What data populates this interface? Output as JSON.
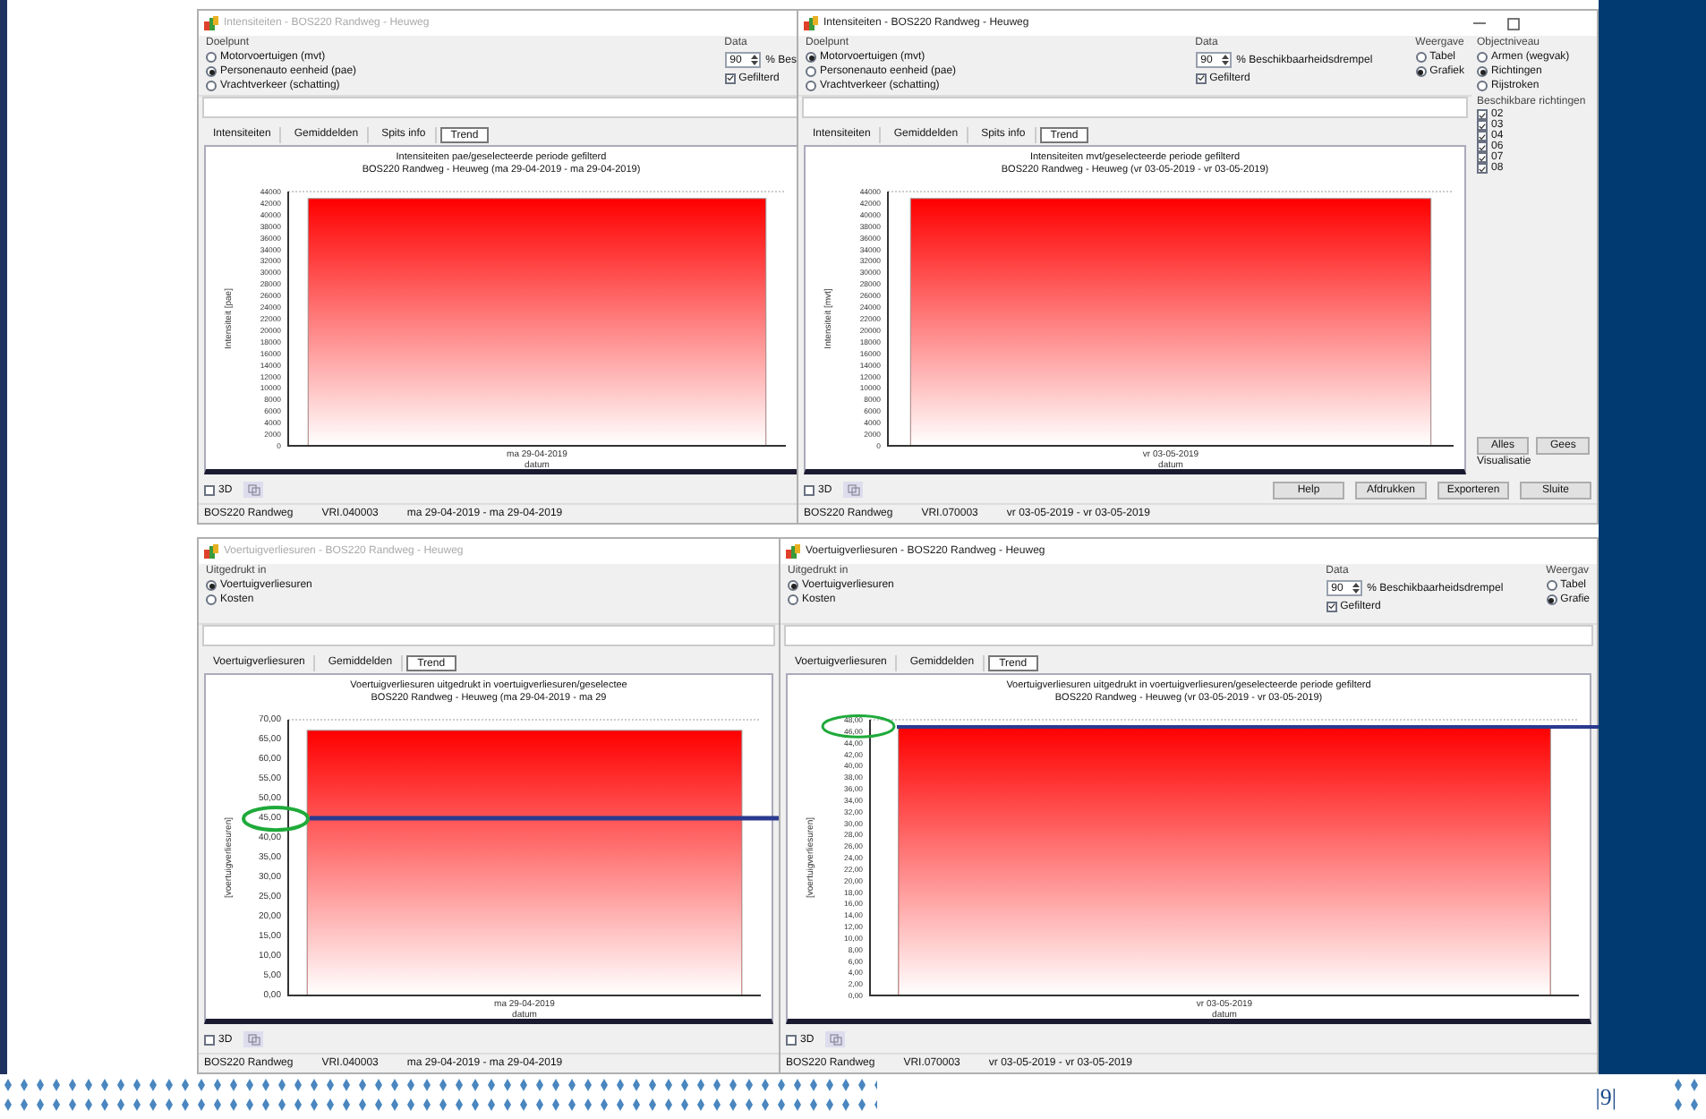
{
  "windows": [
    {
      "title": "Intensiteiten - BOS220 Randweg - Heuweg",
      "active": false,
      "window_buttons": false,
      "groups": [
        {
          "kind": "radio",
          "label": "Doelpunt",
          "options": [
            {
              "label": "Motorvoertuigen (mvt)",
              "selected": false
            },
            {
              "label": "Personenauto eenheid (pae)",
              "selected": true
            },
            {
              "label": "Vrachtverkeer (schatting)",
              "selected": false
            }
          ]
        },
        {
          "kind": "data",
          "label": "Data",
          "spinner_value": "90",
          "threshold_label": "% Bes",
          "filter": {
            "label": "Gefilterd",
            "checked": true
          }
        }
      ],
      "tabs": [
        {
          "label": "Intensiteiten",
          "selected": false
        },
        {
          "label": "Gemiddelden",
          "selected": false
        },
        {
          "label": "Spits info",
          "selected": false
        },
        {
          "label": "Trend",
          "selected": true
        }
      ],
      "chart_subtitle": "BOS220 Randweg - Heuweg (ma 29-04-2019 - ma 29-04-2019)",
      "chart_data": {
        "type": "bar",
        "title": "Intensiteiten pae/geselecteerde periode gefilterd",
        "xlabel": "datum",
        "ylabel": "Intensiteit [pae]",
        "categories": [
          "ma 29-04-2019"
        ],
        "values": [
          42800
        ],
        "ylim": [
          0,
          44000
        ],
        "yticks": [
          0,
          2000,
          4000,
          6000,
          8000,
          10000,
          12000,
          14000,
          16000,
          18000,
          20000,
          22000,
          24000,
          26000,
          28000,
          30000,
          32000,
          34000,
          36000,
          38000,
          40000,
          42000,
          44000
        ]
      },
      "three_d": {
        "label": "3D",
        "checked": false
      },
      "status": [
        "BOS220 Randweg",
        "VRI.040003",
        "ma 29-04-2019 - ma 29-04-2019"
      ]
    },
    {
      "title": "Intensiteiten - BOS220 Randweg - Heuweg",
      "active": true,
      "window_buttons": true,
      "groups": [
        {
          "kind": "radio",
          "label": "Doelpunt",
          "options": [
            {
              "label": "Motorvoertuigen (mvt)",
              "selected": true
            },
            {
              "label": "Personenauto eenheid (pae)",
              "selected": false
            },
            {
              "label": "Vrachtverkeer (schatting)",
              "selected": false
            }
          ]
        },
        {
          "kind": "data",
          "label": "Data",
          "spinner_value": "90",
          "threshold_label": "% Beschikbaarheidsdrempel",
          "filter": {
            "label": "Gefilterd",
            "checked": true
          }
        },
        {
          "kind": "radio",
          "label": "Weergave",
          "options": [
            {
              "label": "Tabel",
              "selected": false
            },
            {
              "label": "Grafiek",
              "selected": true
            }
          ]
        }
      ],
      "side_groups": [
        {
          "kind": "radio",
          "label": "Objectniveau",
          "options": [
            {
              "label": "Armen (wegvak)",
              "selected": false
            },
            {
              "label": "Richtingen",
              "selected": true
            },
            {
              "label": "Rijstroken",
              "selected": false
            }
          ]
        },
        {
          "kind": "checklist",
          "label": "Beschikbare richtingen",
          "items": [
            {
              "label": "02",
              "checked": true
            },
            {
              "label": "03",
              "checked": true
            },
            {
              "label": "04",
              "checked": true
            },
            {
              "label": "06",
              "checked": true
            },
            {
              "label": "07",
              "checked": true
            },
            {
              "label": "08",
              "checked": true
            }
          ]
        }
      ],
      "side_buttons": [
        "Alles",
        "Gees"
      ],
      "side_note": "Visualisatie",
      "tabs": [
        {
          "label": "Intensiteiten",
          "selected": false
        },
        {
          "label": "Gemiddelden",
          "selected": false
        },
        {
          "label": "Spits info",
          "selected": false
        },
        {
          "label": "Trend",
          "selected": true
        }
      ],
      "chart_subtitle": "BOS220 Randweg - Heuweg (vr 03-05-2019 - vr 03-05-2019)",
      "chart_data": {
        "type": "bar",
        "title": "Intensiteiten mvt/geselecteerde periode gefilterd",
        "xlabel": "datum",
        "ylabel": "Intensiteit [mvt]",
        "categories": [
          "vr 03-05-2019"
        ],
        "values": [
          42800
        ],
        "ylim": [
          0,
          44000
        ],
        "yticks": [
          0,
          2000,
          4000,
          6000,
          8000,
          10000,
          12000,
          14000,
          16000,
          18000,
          20000,
          22000,
          24000,
          26000,
          28000,
          30000,
          32000,
          34000,
          36000,
          38000,
          40000,
          42000,
          44000
        ]
      },
      "three_d": {
        "label": "3D",
        "checked": false
      },
      "footer_buttons": [
        "Help",
        "Afdrukken",
        "Exporteren",
        "Sluite"
      ],
      "status": [
        "BOS220 Randweg",
        "VRI.070003",
        "vr 03-05-2019 - vr 03-05-2019"
      ]
    },
    {
      "title": "Voertuigverliesuren - BOS220 Randweg - Heuweg",
      "active": false,
      "window_buttons": false,
      "groups": [
        {
          "kind": "radio",
          "label": "Uitgedrukt in",
          "options": [
            {
              "label": "Voertuigverliesuren",
              "selected": true
            },
            {
              "label": "Kosten",
              "selected": false
            }
          ]
        }
      ],
      "tabs": [
        {
          "label": "Voertuigverliesuren",
          "selected": false
        },
        {
          "label": "Gemiddelden",
          "selected": false
        },
        {
          "label": "Trend",
          "selected": true
        }
      ],
      "chart_subtitle": "BOS220 Randweg - Heuweg (ma 29-04-2019 - ma 29",
      "chart_data": {
        "type": "bar",
        "title": "Voertuigverliesuren uitgedrukt in voertuigverliesuren/geselectee",
        "xlabel": "datum",
        "ylabel": "[voertuigverliesuren]",
        "categories": [
          "ma 29-04-2019"
        ],
        "values": [
          67.3
        ],
        "ylim": [
          0,
          70
        ],
        "yticks": [
          {
            "value": 0,
            "label": "0,00"
          },
          {
            "value": 5,
            "label": "5,00"
          },
          {
            "value": 10,
            "label": "10,00"
          },
          {
            "value": 15,
            "label": "15,00"
          },
          {
            "value": 20,
            "label": "20,00"
          },
          {
            "value": 25,
            "label": "25,00"
          },
          {
            "value": 30,
            "label": "30,00"
          },
          {
            "value": 35,
            "label": "35,00"
          },
          {
            "value": 40,
            "label": "40,00"
          },
          {
            "value": 45,
            "label": "45,00"
          },
          {
            "value": 50,
            "label": "50,00"
          },
          {
            "value": 55,
            "label": "55,00"
          },
          {
            "value": 60,
            "label": "60,00"
          },
          {
            "value": 65,
            "label": "65,00"
          },
          {
            "value": 70,
            "label": "70,00"
          }
        ]
      },
      "three_d": {
        "label": "3D",
        "checked": false
      },
      "status": [
        "BOS220 Randweg",
        "VRI.040003",
        "ma 29-04-2019 - ma 29-04-2019"
      ]
    },
    {
      "title": "Voertuigverliesuren - BOS220 Randweg - Heuweg",
      "active": true,
      "window_buttons": false,
      "groups": [
        {
          "kind": "radio",
          "label": "Uitgedrukt in",
          "options": [
            {
              "label": "Voertuigverliesuren",
              "selected": true
            },
            {
              "label": "Kosten",
              "selected": false
            }
          ]
        },
        {
          "kind": "data",
          "label": "Data",
          "spinner_value": "90",
          "threshold_label": "% Beschikbaarheidsdrempel",
          "filter": {
            "label": "Gefilterd",
            "checked": true
          }
        },
        {
          "kind": "radio",
          "label": "Weergav",
          "options": [
            {
              "label": "Tabel",
              "selected": false
            },
            {
              "label": "Grafie",
              "selected": true
            }
          ]
        }
      ],
      "tabs": [
        {
          "label": "Voertuigverliesuren",
          "selected": false
        },
        {
          "label": "Gemiddelden",
          "selected": false
        },
        {
          "label": "Trend",
          "selected": true
        }
      ],
      "chart_subtitle": "BOS220 Randweg - Heuweg (vr 03-05-2019 - vr 03-05-2019)",
      "chart_data": {
        "type": "bar",
        "title": "Voertuigverliesuren uitgedrukt in voertuigverliesuren/geselecteerde periode gefilterd",
        "xlabel": "datum",
        "ylabel": "[voertuigverliesuren]",
        "categories": [
          "vr 03-05-2019"
        ],
        "values": [
          46.7
        ],
        "ylim": [
          0,
          48
        ],
        "yticks": [
          {
            "value": 0,
            "label": "0,00"
          },
          {
            "value": 2,
            "label": "2,00"
          },
          {
            "value": 4,
            "label": "4,00"
          },
          {
            "value": 6,
            "label": "6,00"
          },
          {
            "value": 8,
            "label": "8,00"
          },
          {
            "value": 10,
            "label": "10,00"
          },
          {
            "value": 12,
            "label": "12,00"
          },
          {
            "value": 14,
            "label": "14,00"
          },
          {
            "value": 16,
            "label": "16,00"
          },
          {
            "value": 18,
            "label": "18,00"
          },
          {
            "value": 20,
            "label": "20,00"
          },
          {
            "value": 22,
            "label": "22,00"
          },
          {
            "value": 24,
            "label": "24,00"
          },
          {
            "value": 26,
            "label": "26,00"
          },
          {
            "value": 28,
            "label": "28,00"
          },
          {
            "value": 30,
            "label": "30,00"
          },
          {
            "value": 32,
            "label": "32,00"
          },
          {
            "value": 34,
            "label": "34,00"
          },
          {
            "value": 36,
            "label": "36,00"
          },
          {
            "value": 38,
            "label": "38,00"
          },
          {
            "value": 40,
            "label": "40,00"
          },
          {
            "value": 42,
            "label": "42,00"
          },
          {
            "value": 44,
            "label": "44,00"
          },
          {
            "value": 46,
            "label": "46,00"
          },
          {
            "value": 48,
            "label": "48,00"
          }
        ]
      },
      "three_d": {
        "label": "3D",
        "checked": false
      },
      "status": [
        "BOS220 Randweg",
        "VRI.070003",
        "vr 03-05-2019 - vr 03-05-2019"
      ]
    }
  ],
  "page_number": "|9|"
}
